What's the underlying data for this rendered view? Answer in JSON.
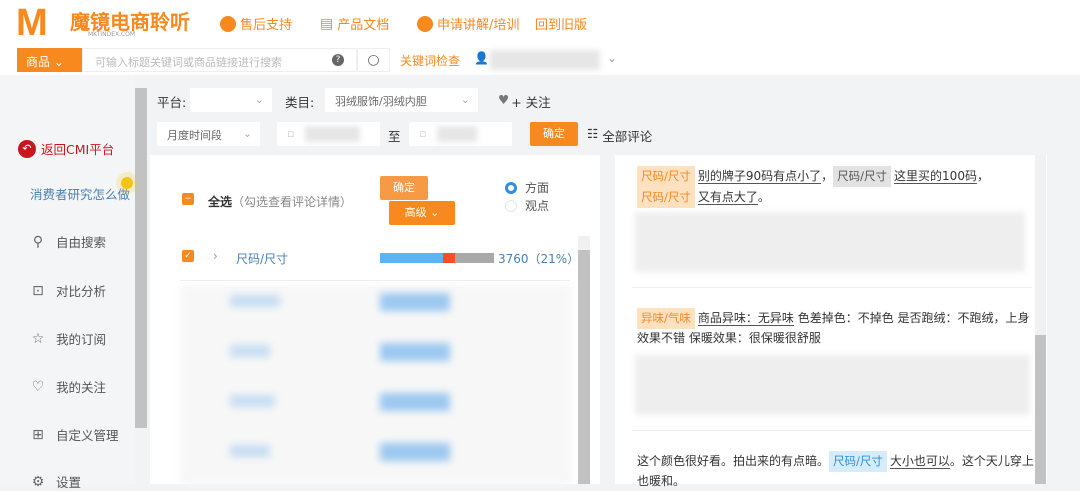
{
  "header": {
    "logo_letter": "M",
    "logo_title": "魔镜电商聆听",
    "logo_sub": "MKTINDEX.COM",
    "nav": [
      "售后支持",
      "产品文档",
      "申请讲解/培训",
      "回到旧版"
    ]
  },
  "search": {
    "category": "商品",
    "placeholder": "可输入标题关键词或商品链接进行搜索",
    "help": "?",
    "keyword_check": "关键词检查"
  },
  "sidebar": {
    "back": "返回CMI平台",
    "guide": "消费者研究怎么做",
    "items": [
      {
        "icon": "search-icon",
        "label": "自由搜索"
      },
      {
        "icon": "compare-icon",
        "label": "对比分析"
      },
      {
        "icon": "star-icon",
        "label": "我的订阅"
      },
      {
        "icon": "heart-icon",
        "label": "我的关注"
      },
      {
        "icon": "grid-icon",
        "label": "自定义管理"
      },
      {
        "icon": "gear-icon",
        "label": "设置"
      }
    ]
  },
  "filters": {
    "platform_label": "平台:",
    "category_label": "类目:",
    "category_value": "羽绒服饰/羽绒内胆",
    "follow": "+ 关注",
    "period": "月度时间段",
    "to": "至",
    "confirm": "确定",
    "all_comments": "全部评论"
  },
  "aspects": {
    "select_all": "全选",
    "select_hint": "（勾选查看评论详情）",
    "confirm": "确定",
    "advanced": "高级",
    "radio": [
      "方面",
      "观点"
    ],
    "row": {
      "label": "尺码/尺寸",
      "count": "3760（21%）",
      "positive_pct": 55,
      "negative_pct": 11,
      "neutral_pct": 34
    },
    "colors": {
      "positive": "#5ab4f5",
      "negative": "#f4511e",
      "neutral": "#a9a9a9"
    }
  },
  "comments": [
    {
      "parts": [
        {
          "tag": "尺码/尺寸",
          "style": "o"
        },
        {
          "text": "别的牌子90码有点小了",
          "u": true
        },
        {
          "text": "，"
        },
        {
          "tag": "尺码/尺寸",
          "style": "g"
        },
        {
          "text": "这里买的100码",
          "u": true
        },
        {
          "text": "，"
        },
        {
          "tag": "尺码/尺寸",
          "style": "o"
        },
        {
          "text": "又有点大了",
          "u": true
        },
        {
          "text": "。"
        }
      ]
    },
    {
      "parts": [
        {
          "tag": "异味/气味",
          "style": "o"
        },
        {
          "text": "商品异味：无异味",
          "u": true
        },
        {
          "text": " 色差掉色：不掉色 是否跑绒：不跑绒，上身效果不错 保暖效果：很保暖很舒服"
        }
      ]
    },
    {
      "parts": [
        {
          "text": "这个颜色很好看。拍出来的有点暗。"
        },
        {
          "tag": "尺码/尺寸",
          "style": "b"
        },
        {
          "text": "大小也可以",
          "u": true
        },
        {
          "text": "。这个天儿穿上也暖和。"
        }
      ]
    }
  ]
}
